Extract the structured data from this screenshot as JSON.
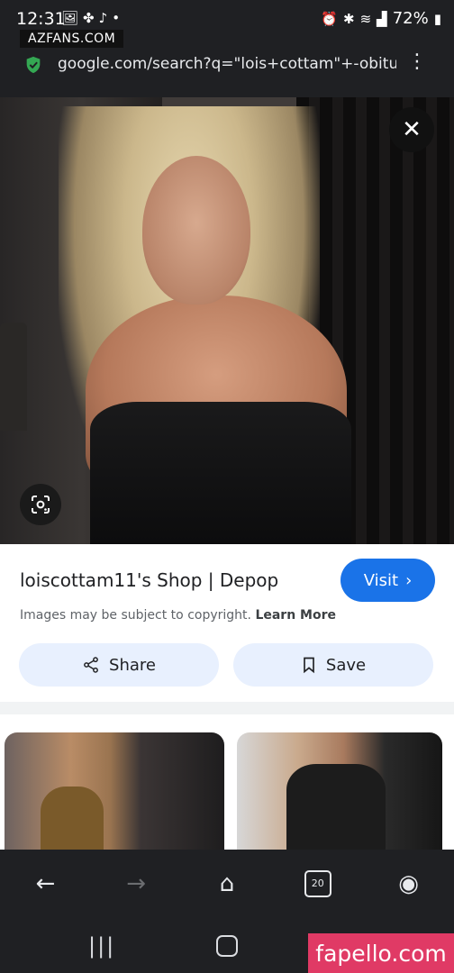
{
  "status_bar": {
    "time": "12:31",
    "battery": "72%",
    "left_icons": [
      "image-icon",
      "pinwheel-icon",
      "tiktok-icon",
      "dot-icon"
    ],
    "right_icons": [
      "alarm-icon",
      "bluetooth-icon",
      "wifi-icon",
      "signal-icon",
      "battery-icon"
    ]
  },
  "watermark_top": "AZFANS.COM",
  "url_bar": {
    "url": "google.com/search?q=\"lois+cottam\"+-obituary",
    "secure_icon": "shield-check-icon",
    "menu_icon": "more-vert-icon"
  },
  "image_viewer": {
    "close_icon": "close-icon",
    "lens_icon": "google-lens-icon"
  },
  "result": {
    "title": "loiscottam11's Shop | Depop",
    "visit_label": "Visit",
    "copyright_text": "Images may be subject to copyright.",
    "learn_more_label": "Learn More",
    "share_label": "Share",
    "save_label": "Save"
  },
  "bottom_nav": {
    "tab_count": "20",
    "items": [
      "back-icon",
      "forward-icon",
      "home-icon",
      "tabs-icon",
      "account-icon"
    ]
  },
  "watermark_bottom": "fapello.com",
  "colors": {
    "accent": "#1a73e8",
    "chip_bg": "#e8f0fe",
    "chrome_bg": "#1f2023",
    "watermark": "#e03a65"
  }
}
